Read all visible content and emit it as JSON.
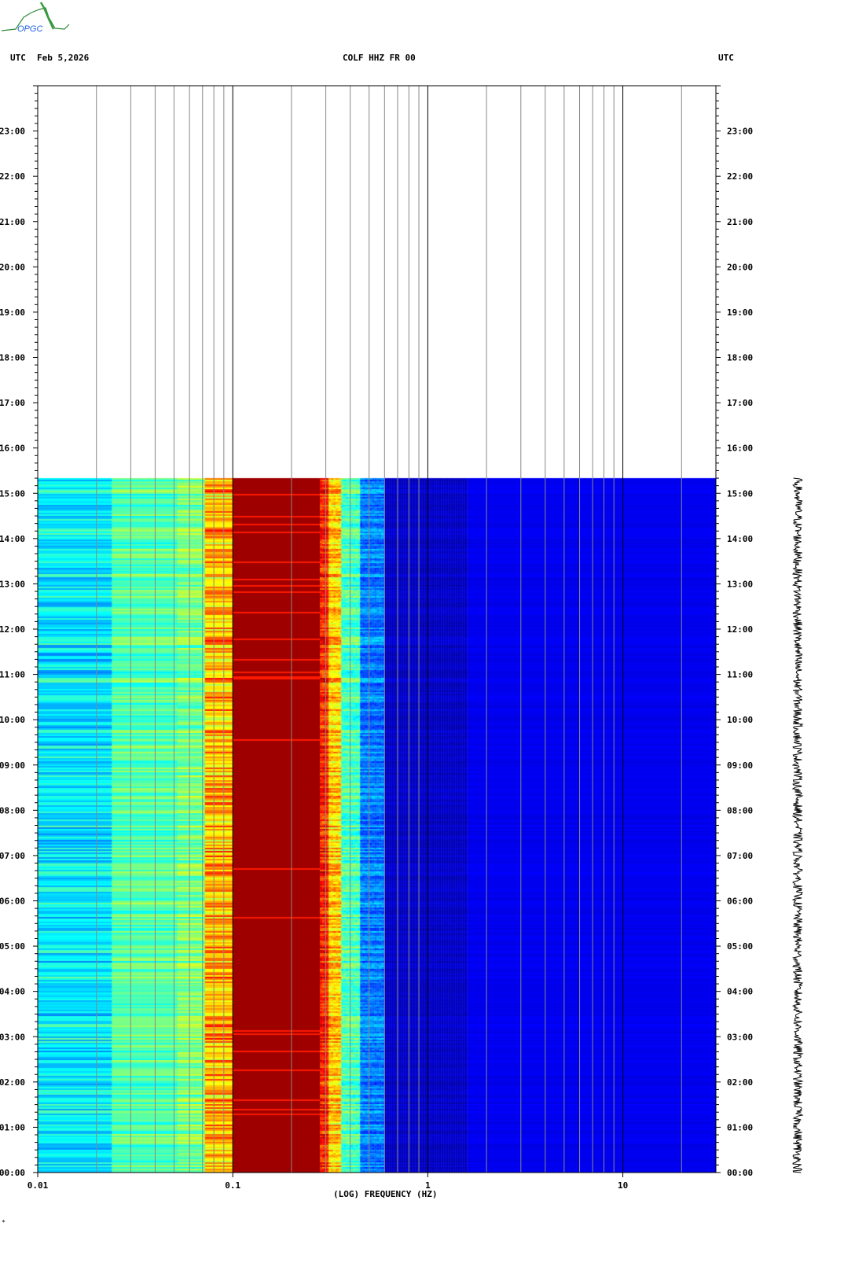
{
  "header": {
    "left_tz": "UTC",
    "date": "Feb 5,2026",
    "station": "COLF HHZ FR 00",
    "right_tz": "UTC",
    "logo_text": "OPGC"
  },
  "footer_mark": "*",
  "chart_data": {
    "type": "heatmap",
    "title": "COLF HHZ FR 00",
    "xlabel": "(LOG) FREQUENCY (HZ)",
    "ylabel": "UTC",
    "x_scale": "log",
    "xlim": [
      0.01,
      30
    ],
    "ylim_hours": [
      0,
      24
    ],
    "data_end_hour": 15.33,
    "x_ticks": [
      {
        "v": 0.01,
        "label": "0.01"
      },
      {
        "v": 0.1,
        "label": "0.1"
      },
      {
        "v": 1,
        "label": "1"
      },
      {
        "v": 10,
        "label": "10"
      }
    ],
    "y_ticks": [
      "00:00",
      "01:00",
      "02:00",
      "03:00",
      "04:00",
      "05:00",
      "06:00",
      "07:00",
      "08:00",
      "09:00",
      "10:00",
      "11:00",
      "12:00",
      "13:00",
      "14:00",
      "15:00",
      "16:00",
      "17:00",
      "18:00",
      "19:00",
      "20:00",
      "21:00",
      "22:00",
      "23:00"
    ],
    "colormap": "jet",
    "band_levels": [
      {
        "f_lo": 0.01,
        "f_hi": 0.024,
        "level": 0.36,
        "spread": 0.08
      },
      {
        "f_lo": 0.024,
        "f_hi": 0.052,
        "level": 0.46,
        "spread": 0.07
      },
      {
        "f_lo": 0.052,
        "f_hi": 0.072,
        "level": 0.5,
        "spread": 0.08
      },
      {
        "f_lo": 0.072,
        "f_hi": 0.1,
        "level": 0.7,
        "spread": 0.12
      },
      {
        "f_lo": 0.1,
        "f_hi": 0.28,
        "level": 1.0,
        "spread": 0.02
      },
      {
        "f_lo": 0.28,
        "f_hi": 0.31,
        "level": 0.85,
        "spread": 0.08
      },
      {
        "f_lo": 0.31,
        "f_hi": 0.36,
        "level": 0.68,
        "spread": 0.1
      },
      {
        "f_lo": 0.36,
        "f_hi": 0.45,
        "level": 0.45,
        "spread": 0.08
      },
      {
        "f_lo": 0.45,
        "f_hi": 0.6,
        "level": 0.25,
        "spread": 0.07
      },
      {
        "f_lo": 0.6,
        "f_hi": 1.6,
        "level": 0.07,
        "spread": 0.02
      },
      {
        "f_lo": 1.6,
        "f_hi": 30,
        "level": 0.11,
        "spread": 0.01
      }
    ]
  }
}
